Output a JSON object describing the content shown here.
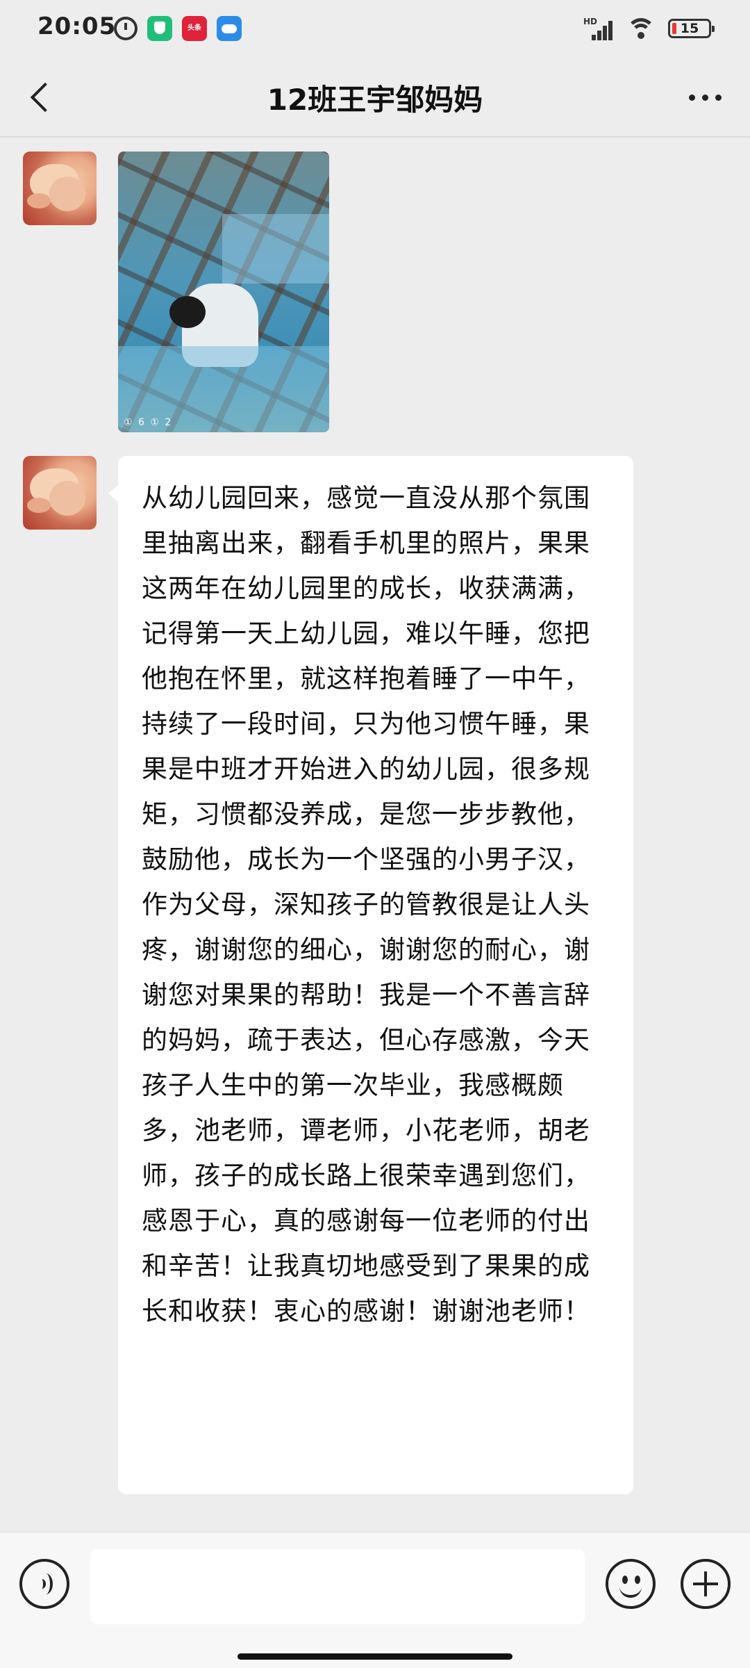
{
  "status_bar": {
    "time": "20:05",
    "network_label": "HD",
    "battery_level": "15",
    "app_icons": [
      "alarm-icon",
      "shield-app-icon",
      "news-app-icon",
      "cloud-app-icon"
    ],
    "news_app_text": "头条"
  },
  "header": {
    "title": "12班王宇邹妈妈"
  },
  "messages": [
    {
      "type": "image",
      "sender": "contact",
      "overlay_text": "① 6 ① 2"
    },
    {
      "type": "text",
      "sender": "contact",
      "text": "从幼儿园回来，感觉一直没从那个氛围里抽离出来，翻看手机里的照片，果果这两年在幼儿园里的成长，收获满满，记得第一天上幼儿园，难以午睡，您把他抱在怀里，就这样抱着睡了一中午，持续了一段时间，只为他习惯午睡，果果是中班才开始进入的幼儿园，很多规矩，习惯都没养成，是您一步步教他，鼓励他，成长为一个坚强的小男子汉，作为父母，深知孩子的管教很是让人头疼，谢谢您的细心，谢谢您的耐心，谢谢您对果果的帮助！我是一个不善言辞的妈妈，疏于表达，但心存感激，今天孩子人生中的第一次毕业，我感概颇多，池老师，谭老师，小花老师，胡老师，孩子的成长路上很荣幸遇到您们，感恩于心，真的感谢每一位老师的付出和辛苦！让我真切地感受到了果果的成长和收获！衷心的感谢！谢谢池老师！"
    }
  ],
  "input_bar": {
    "input_value": ""
  },
  "colors": {
    "background": "#ededed",
    "bubble": "#ffffff",
    "battery_low": "#e53935"
  }
}
